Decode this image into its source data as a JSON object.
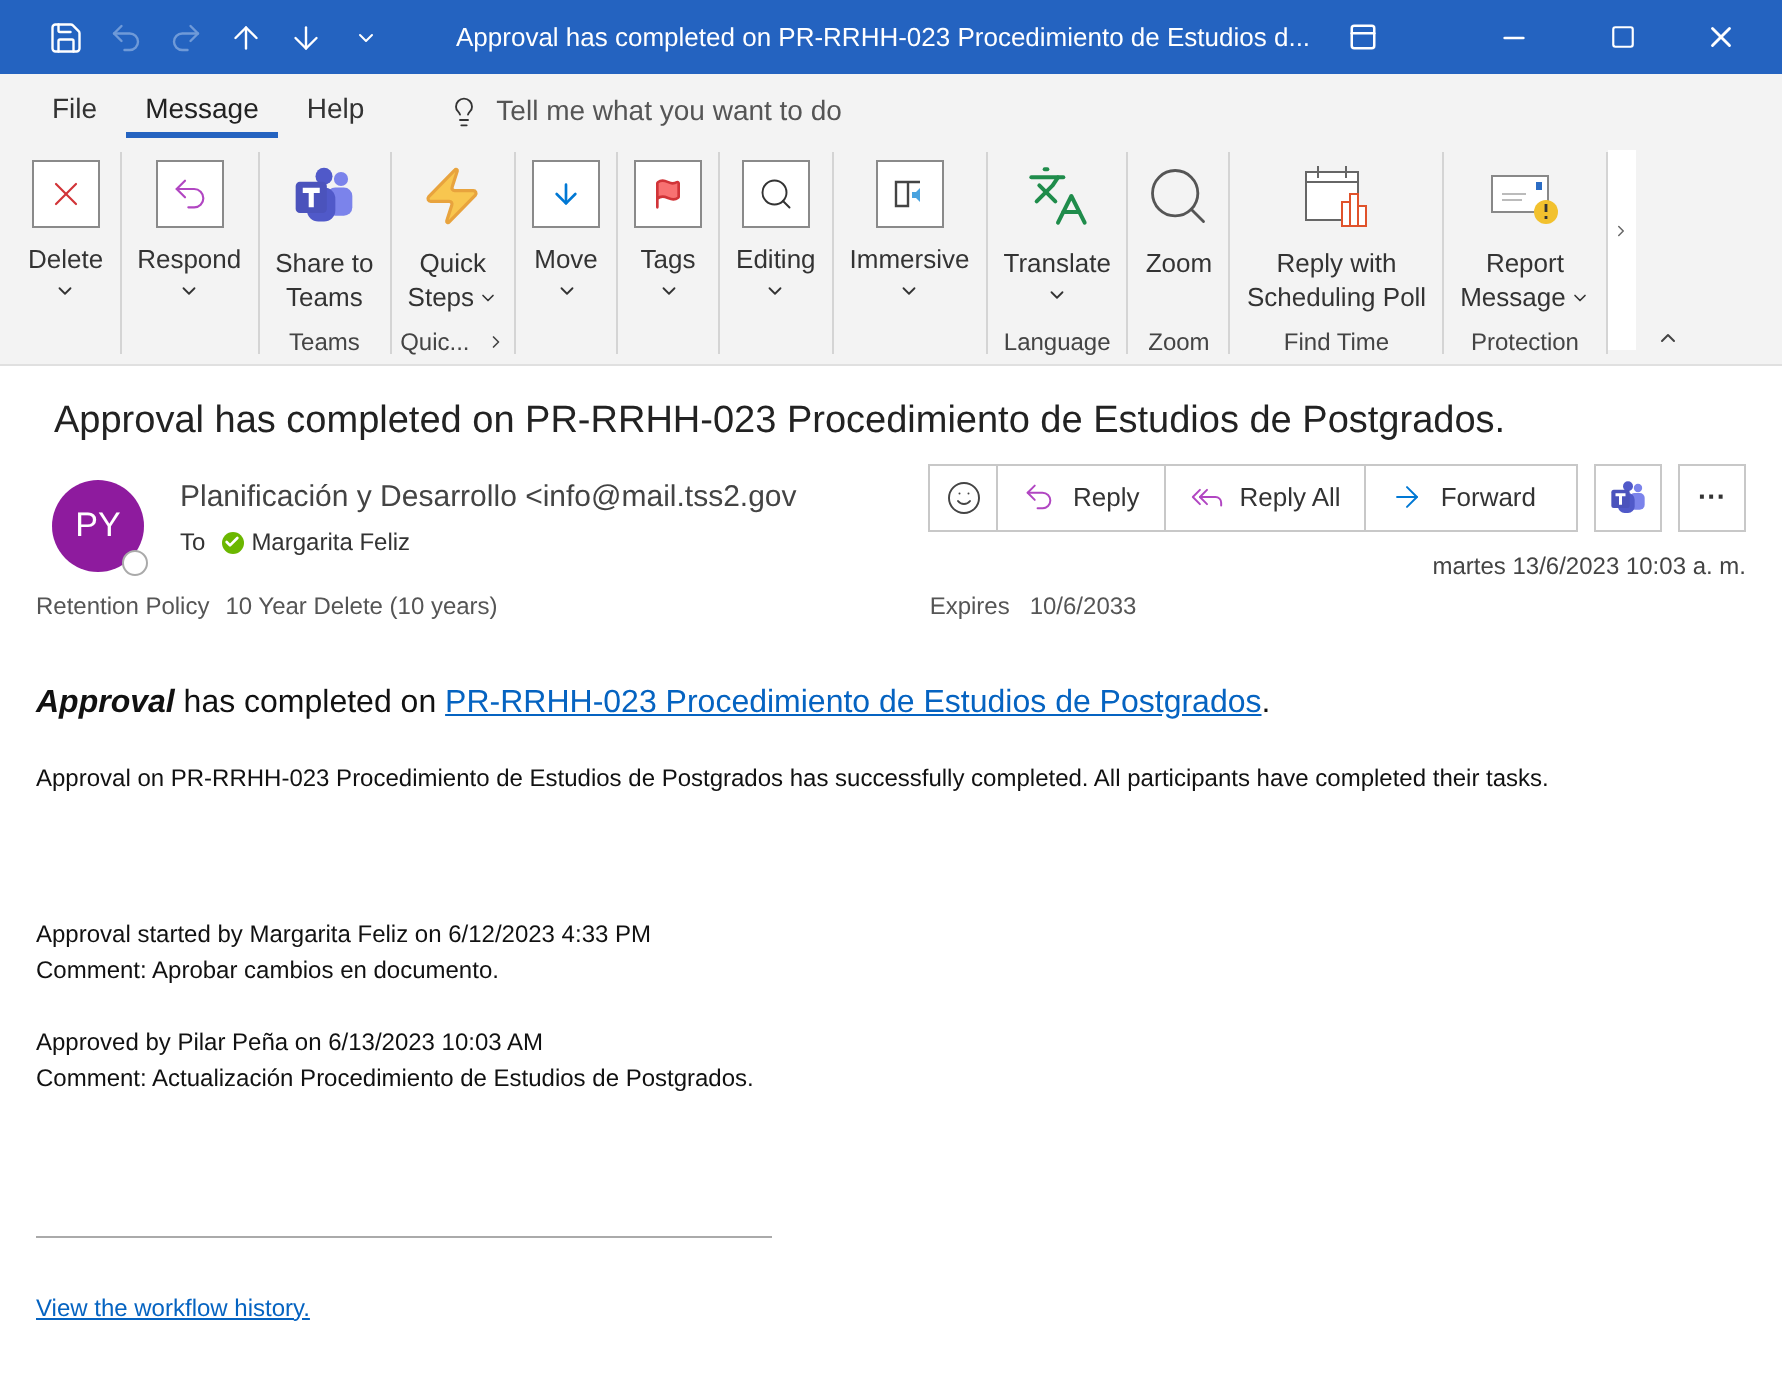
{
  "title_bar": {
    "quick_access": [
      {
        "kind": "save",
        "disabled": false
      },
      {
        "kind": "undo",
        "disabled": true
      },
      {
        "kind": "redo",
        "disabled": true
      },
      {
        "kind": "up",
        "disabled": false
      },
      {
        "kind": "down",
        "disabled": false
      },
      {
        "kind": "customize",
        "disabled": false
      }
    ],
    "title": "Approval has completed on PR-RRHH-023 Procedimiento de Estudios d..."
  },
  "tabs": [
    {
      "label": "File",
      "selected": false
    },
    {
      "label": "Message",
      "selected": true
    },
    {
      "label": "Help",
      "selected": false
    }
  ],
  "search": {
    "placeholder": "Tell me what you want to do"
  },
  "ribbon": [
    {
      "buttons": [
        {
          "kind": "delete",
          "lines": [
            "Delete"
          ],
          "dropdown": true
        }
      ]
    },
    {
      "buttons": [
        {
          "kind": "respond",
          "lines": [
            "Respond"
          ],
          "dropdown": true
        }
      ]
    },
    {
      "label": "Teams",
      "buttons": [
        {
          "kind": "teams",
          "lines": [
            "Share to",
            "Teams"
          ]
        }
      ]
    },
    {
      "label": "Quic...",
      "launcher": true,
      "buttons": [
        {
          "kind": "quick",
          "lines": [
            "Quick",
            "Steps"
          ],
          "dropdown": true,
          "dropdown_inline": true
        }
      ]
    },
    {
      "buttons": [
        {
          "kind": "move",
          "lines": [
            "Move"
          ],
          "dropdown": true
        }
      ]
    },
    {
      "buttons": [
        {
          "kind": "tags",
          "lines": [
            "Tags"
          ],
          "dropdown": true
        }
      ]
    },
    {
      "buttons": [
        {
          "kind": "editing",
          "lines": [
            "Editing"
          ],
          "dropdown": true
        }
      ]
    },
    {
      "buttons": [
        {
          "kind": "immersive",
          "lines": [
            "Immersive"
          ],
          "dropdown": true
        }
      ]
    },
    {
      "label": "Language",
      "buttons": [
        {
          "kind": "translate",
          "lines": [
            "Translate"
          ],
          "dropdown": true
        }
      ]
    },
    {
      "label": "Zoom",
      "buttons": [
        {
          "kind": "zoom",
          "lines": [
            "Zoom"
          ]
        }
      ]
    },
    {
      "label": "Find Time",
      "buttons": [
        {
          "kind": "poll",
          "lines": [
            "Reply with",
            "Scheduling Poll"
          ]
        }
      ]
    },
    {
      "label": "Protection",
      "buttons": [
        {
          "kind": "report",
          "lines": [
            "Report",
            "Message"
          ],
          "dropdown": true,
          "dropdown_inline": true
        }
      ]
    }
  ],
  "message": {
    "subject": "Approval has completed on PR-RRHH-023 Procedimiento de Estudios de Postgrados.",
    "avatar": "PY",
    "sender": "Planificación y Desarrollo <info@mail.tss2.gov",
    "to_label": "To",
    "recipient": "Margarita Feliz",
    "actions": [
      {
        "kind": "emoji"
      },
      {
        "kind": "reply",
        "label": "Reply"
      },
      {
        "kind": "reply_all",
        "label": "Reply All"
      },
      {
        "kind": "forward",
        "label": "Forward"
      },
      {
        "kind": "teams"
      },
      {
        "kind": "more",
        "label": "···"
      }
    ],
    "date": "martes 13/6/2023 10:03 a. m.",
    "retention_label": "Retention Policy",
    "retention": "10 Year Delete (10 years)",
    "expires_label": "Expires",
    "expires": "10/6/2033"
  },
  "body": {
    "heading": {
      "lead": "Approval",
      "text": " has completed on ",
      "link": "PR-RRHH-023 Procedimiento de Estudios de Postgrados",
      "tail": "."
    },
    "intro": "Approval on PR-RRHH-023 Procedimiento de Estudios de Postgrados has successfully completed. All participants have completed their tasks.",
    "blocks": [
      [
        "Approval started by Margarita Feliz on 6/12/2023 4:33 PM",
        "Comment: Aprobar cambios en documento."
      ],
      [
        "Approved by Pilar Peña on 6/13/2023 10:03 AM",
        "Comment: Actualización Procedimiento de Estudios de Postgrados."
      ]
    ],
    "footer_link": "View the workflow history."
  }
}
